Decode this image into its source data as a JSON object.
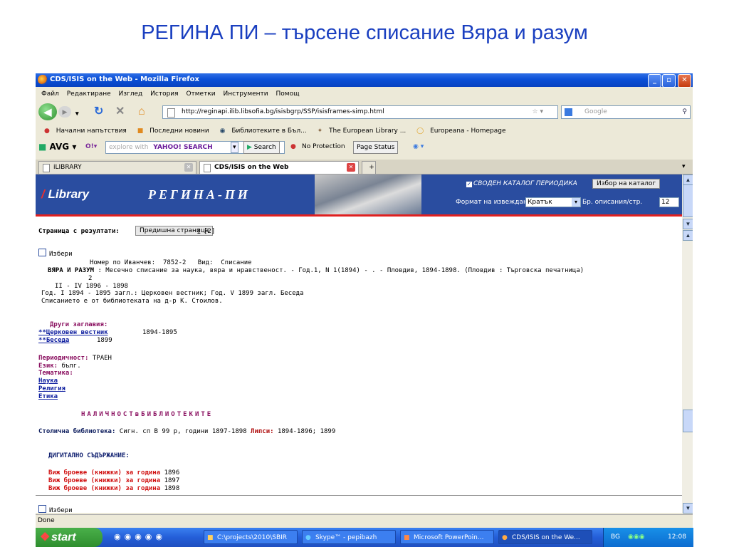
{
  "slide_title": "РЕГИНА ПИ – търсене списание Вяра и разум",
  "window": {
    "title": "CDS/ISIS on the Web - Mozilla Firefox",
    "controls": {
      "minimize": "_",
      "maximize": "▫",
      "close": "✕"
    }
  },
  "menu": [
    "Файл",
    "Редактиране",
    "Изглед",
    "История",
    "Отметки",
    "Инструменти",
    "Помощ"
  ],
  "nav": {
    "url": "http://reginapi.ilib.libsofia.bg/isisbgrp/SSP/isisframes-simp.html",
    "search_placeholder": "Google"
  },
  "bookmarks": [
    "Начални напътствия",
    "Последни новини",
    "Библиотеките в Бъл...",
    "The European Library ...",
    "Europeana - Homepage"
  ],
  "avg_toolbar": {
    "brand": "AVG",
    "explore": "explore with",
    "yahoo": "YAHOO! SEARCH",
    "search_btn": "Search",
    "protection": "No Protection",
    "page_status": "Page Status"
  },
  "tabs": [
    {
      "label": "iLIBRARY"
    },
    {
      "label": "CDS/ISIS on the Web"
    }
  ],
  "header": {
    "library_slash": "/",
    "library": "Library",
    "regina": "РЕГИНА-ПИ",
    "catalog_checkbox": "СВОДЕН КАТАЛОГ ПЕРИОДИКА",
    "catalog_button": "Избор на каталог",
    "format_label": "Формат на извеждане",
    "format_value": "Кратък",
    "per_page_label": "Бр. описания/стр.",
    "per_page_value": "12"
  },
  "results": {
    "pages_label": "Страница с резултати:",
    "prev_button": "Предишна страница",
    "current_page": "1",
    "next_page": "[2]",
    "select_label": "Избери",
    "ivanchev_line": "Номер по Иванчев:  7852-2   Вид:  Списание",
    "title_bold": "ВЯРА И РАЗУМ",
    "title_rest": " : Месечно списание за наука, вяра и нравственост. - Год.1, N 1(1894) - . - Пловдив, 1894-1898. (Пловдив : Търговска печатница)",
    "line2": "2",
    "line3": "II - IV 1896 - 1898",
    "line4": "Год. I 1894 - 1895 загл.: Церковен вестник; Год. V 1899 загл. Беседа",
    "line5": "Списанието е от библиотеката на д-р К. Стоилов.",
    "other_titles_label": "Други заглавия:",
    "other_titles": [
      {
        "name": "**Церковен вестник",
        "years": "1894-1895"
      },
      {
        "name": "**Беседа",
        "years": "1899"
      }
    ],
    "periodicity_label": "Периодичност:",
    "periodicity_value": "ТРАЕН",
    "language_label": "Език:",
    "language_value": "бълг.",
    "subject_label": "Тематика:",
    "subjects": [
      "Наука",
      "Религия",
      "Етика"
    ],
    "holdings_title": "НАЛИЧНОСТвБИБЛИОТЕКИТЕ",
    "holdings_library": "Столична библиотека:",
    "holdings_info": " Сигн. сп В 99 р, години 1897-1898 ",
    "holdings_missing_label": "Липси:",
    "holdings_missing": " 1894-1896; 1899",
    "digital_title": "ДИГИТАЛНО СЪДЪРЖАНИЕ:",
    "digital_link_text": "Виж броеве (книжки) за година",
    "digital_years": [
      "1896",
      "1897",
      "1898"
    ],
    "select_label_2": "Избери"
  },
  "status": "Done",
  "taskbar": {
    "start": "start",
    "items": [
      {
        "label": "C:\\projects\\2010\\SBIR"
      },
      {
        "label": "Skype™ - pepibazh"
      },
      {
        "label": "Microsoft PowerPoin..."
      },
      {
        "label": "CDS/ISIS on the We..."
      }
    ],
    "lang": "BG",
    "clock": "12:08"
  },
  "colors": {
    "slide_title": "#1a3fc0",
    "header_bg": "#2a4da0",
    "accent_red": "#e02020",
    "taskbar": "#245ed8"
  }
}
